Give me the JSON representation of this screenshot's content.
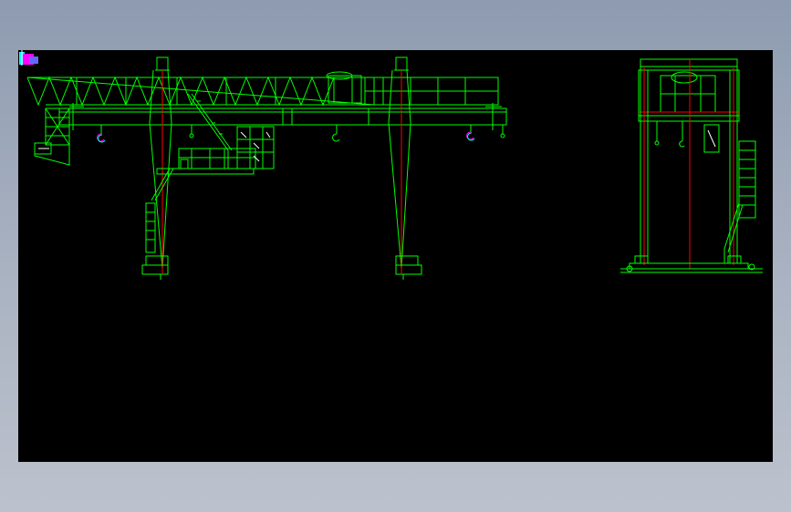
{
  "viewer": {
    "background": "#000000",
    "line_color": "#00ff00",
    "centerline_color": "#ff0000",
    "hook_color": "#ff00ff",
    "detail_color": "#00ffff"
  },
  "drawing": {
    "front_view": "gantry-crane-elevation",
    "side_view": "gantry-crane-end-view"
  }
}
